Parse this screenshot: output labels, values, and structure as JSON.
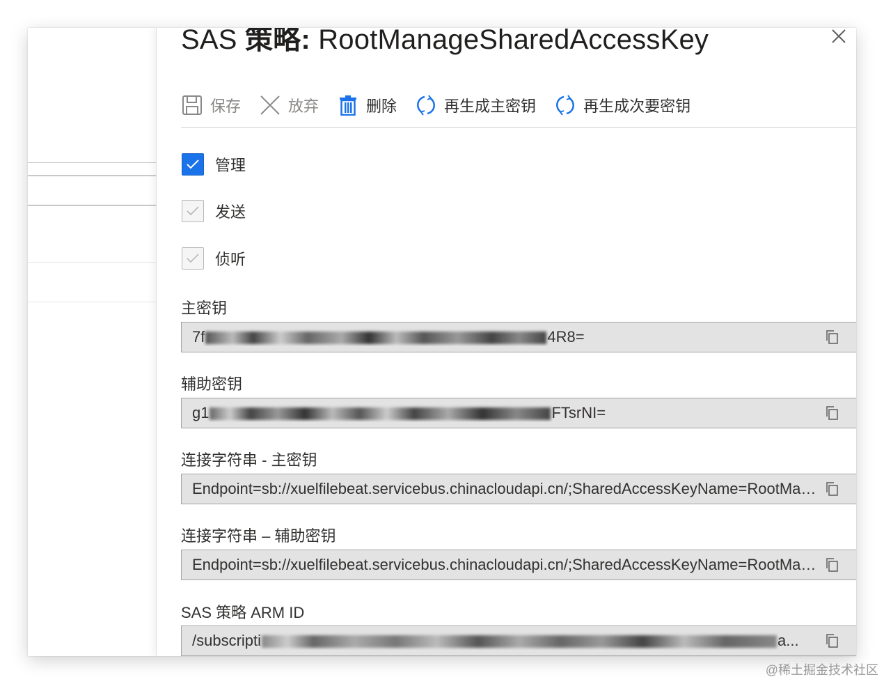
{
  "panel": {
    "title_prefix": "SAS",
    "title_strong": "策略:",
    "title_name": "RootManageSharedAccessKey"
  },
  "toolbar": {
    "save_label": "保存",
    "discard_label": "放弃",
    "delete_label": "删除",
    "regen_primary_label": "再生成主密钥",
    "regen_secondary_label": "再生成次要密钥"
  },
  "claims": [
    {
      "label": "管理",
      "checked": true,
      "enabled": true
    },
    {
      "label": "发送",
      "checked": true,
      "enabled": false
    },
    {
      "label": "侦听",
      "checked": true,
      "enabled": false
    }
  ],
  "fields": {
    "primary_key": {
      "label": "主密钥",
      "value_start": "7f",
      "value_end": "4R8="
    },
    "secondary_key": {
      "label": "辅助密钥",
      "value_start": "g1",
      "value_end": "FTsrNI="
    },
    "conn_primary": {
      "label": "连接字符串 - 主密钥",
      "value": "Endpoint=sb://xuelfilebeat.servicebus.chinacloudapi.cn/;SharedAccessKeyName=RootManageSharedAccessKey"
    },
    "conn_secondary": {
      "label": "连接字符串 – 辅助密钥",
      "value": "Endpoint=sb://xuelfilebeat.servicebus.chinacloudapi.cn/;SharedAccessKeyName=RootManageSharedAccessKey"
    },
    "arm_id": {
      "label": "SAS 策略 ARM ID",
      "value_start": "/subscripti",
      "value_end": "a..."
    }
  },
  "watermark": "@稀土掘金技术社区",
  "colors": {
    "accent": "#1a73e8",
    "field_bg": "#e3e3e3"
  },
  "icons": [
    "save-icon",
    "discard-icon",
    "delete-icon",
    "refresh-icon",
    "copy-icon",
    "close-icon",
    "checkmark-icon"
  ]
}
